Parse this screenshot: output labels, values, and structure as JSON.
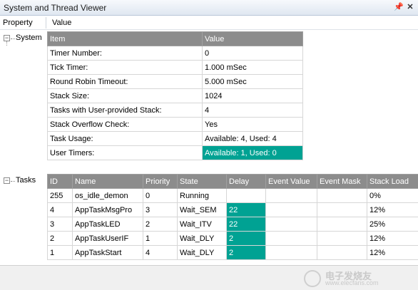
{
  "window": {
    "title": "System and Thread Viewer",
    "pin_icon": "pin-icon",
    "close_icon": "close-icon"
  },
  "columns": {
    "property": "Property",
    "value": "Value"
  },
  "tree": {
    "system_label": "System",
    "tasks_label": "Tasks"
  },
  "system_table": {
    "headers": [
      "Item",
      "Value"
    ],
    "rows": [
      [
        "Timer Number:",
        "0"
      ],
      [
        "Tick Timer:",
        "1.000 mSec"
      ],
      [
        "Round Robin Timeout:",
        "5.000 mSec"
      ],
      [
        "Stack Size:",
        "1024"
      ],
      [
        "Tasks with User-provided Stack:",
        "4"
      ],
      [
        "Stack Overflow Check:",
        "Yes"
      ],
      [
        "Task Usage:",
        "Available: 4, Used: 4"
      ],
      [
        "User Timers:",
        "Available: 1, Used: 0"
      ]
    ]
  },
  "tasks_table": {
    "headers": [
      "ID",
      "Name",
      "Priority",
      "State",
      "Delay",
      "Event Value",
      "Event Mask",
      "Stack Load"
    ],
    "rows": [
      [
        "255",
        "os_idle_demon",
        "0",
        "Running",
        "",
        "",
        "",
        "0%"
      ],
      [
        "4",
        "AppTaskMsgPro",
        "3",
        "Wait_SEM",
        "22",
        "",
        "",
        "12%"
      ],
      [
        "3",
        "AppTaskLED",
        "2",
        "Wait_ITV",
        "22",
        "",
        "",
        "25%"
      ],
      [
        "2",
        "AppTaskUserIF",
        "1",
        "Wait_DLY",
        "2",
        "",
        "",
        "12%"
      ],
      [
        "1",
        "AppTaskStart",
        "4",
        "Wait_DLY",
        "2",
        "",
        "",
        "12%"
      ]
    ]
  },
  "colors": {
    "highlight": "#00a293",
    "header_bg": "#8c8c8c"
  },
  "watermark": {
    "text": "电子发烧友",
    "sub": "www.elecfans.com"
  }
}
